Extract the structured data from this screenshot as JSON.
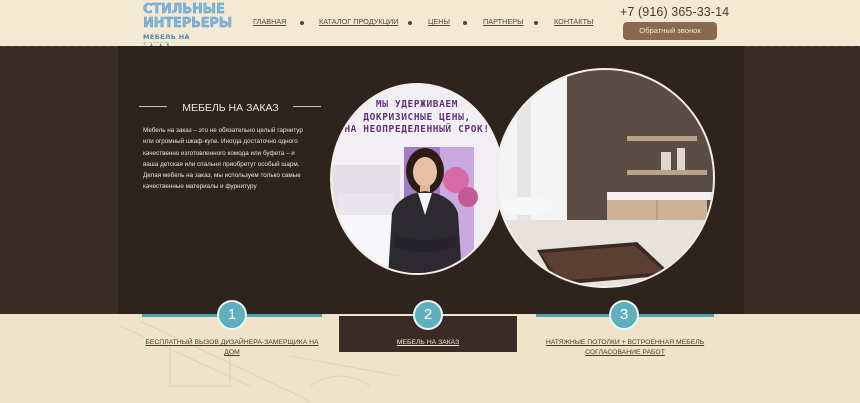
{
  "header": {
    "logo": {
      "line1": "СТИЛЬНЫЕ",
      "line2": "ИНТЕРЬЕРЫ",
      "tagline": "МЕБЕЛЬ НА ЗАКАЗ"
    },
    "nav": [
      "ГЛАВНАЯ",
      "КАТАЛОГ ПРОДУКЦИИ",
      "ЦЕНЫ",
      "ПАРТНЕРЫ",
      "КОНТАКТЫ"
    ],
    "phone": "+7 (916) 365-33-14",
    "callback_label": "Обратный звонок"
  },
  "banner": {
    "title": "МЕБЕЛЬ НА ЗАКАЗ",
    "text": "Мебель на заказ – это не обязательно целый гарнитур или огромный шкаф-купе. Иногда достаточно одного качественно изготовленного комода или буфета – и ваша детская или спальня приобретут особый шарм. Делая мебель на заказ, мы используем только самые качественные материалы и фурнитуру",
    "promo": [
      "МЫ УДЕРЖИВАЕМ",
      "ДОКРИЗИСНЫЕ ЦЕНЫ,",
      "НА НЕОПРЕДЕЛЕННЫЙ СРОК!"
    ]
  },
  "steps": [
    {
      "number": "1",
      "label": "БЕСПЛАТНЫЙ ВЫЗОВ ДИЗАЙНЕРА-ЗАМЕРЩИКА НА ДОМ"
    },
    {
      "number": "2",
      "label": "МЕБЕЛЬ НА ЗАКАЗ"
    },
    {
      "number": "3",
      "label": "НАТЯЖНЫЕ ПОТОЛКИ + ВСТРОЕННАЯ МЕБЕЛЬ СОГЛАСОВАНИЕ РАБОТ"
    }
  ],
  "colors": {
    "brand_blue": "#7fb6dc",
    "banner_dark": "#2f231d",
    "accent_teal": "#5fb0bf",
    "button_brown": "#8a6a4f"
  }
}
